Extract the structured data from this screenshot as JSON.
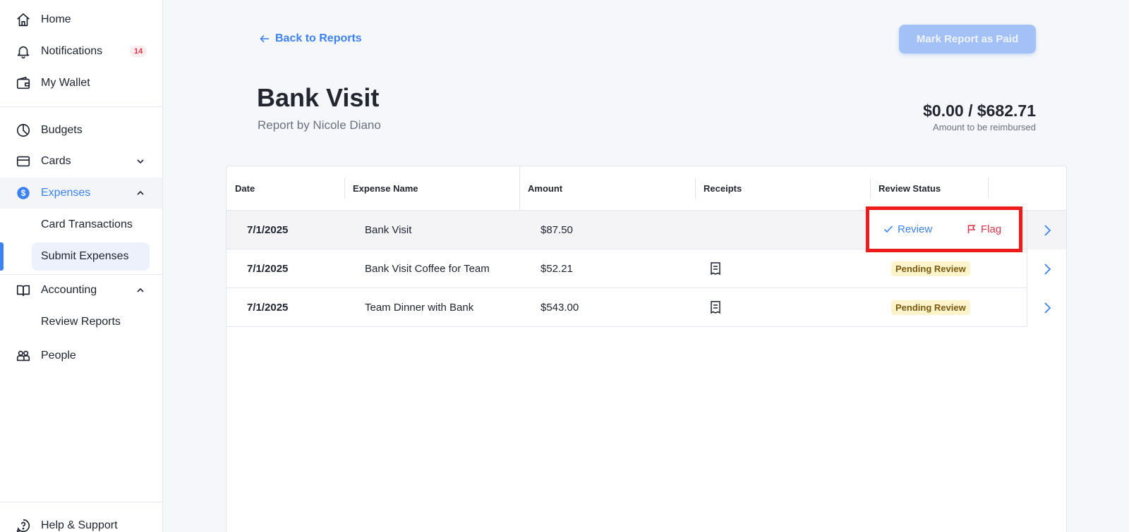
{
  "sidebar": {
    "nav": [
      {
        "label": "Home"
      },
      {
        "label": "Notifications",
        "badge": "14"
      },
      {
        "label": "My Wallet"
      },
      {
        "label": "Budgets"
      },
      {
        "label": "Cards"
      },
      {
        "label": "Expenses"
      },
      {
        "label": "Accounting"
      },
      {
        "label": "People"
      }
    ],
    "expenses_sub": [
      {
        "label": "Card Transactions"
      },
      {
        "label": "Submit Expenses"
      }
    ],
    "accounting_sub": [
      {
        "label": "Review Reports"
      }
    ],
    "help": "Help & Support"
  },
  "header": {
    "back_label": "Back to Reports",
    "mark_paid_label": "Mark Report as Paid"
  },
  "report": {
    "title": "Bank Visit",
    "subtitle": "Report by Nicole Diano",
    "total": "$0.00 / $682.71",
    "total_label": "Amount to be reimbursed"
  },
  "table": {
    "columns": [
      "Date",
      "Expense Name",
      "Amount",
      "Receipts",
      "Review Status"
    ],
    "rows": [
      {
        "date": "7/1/2025",
        "name": "Bank Visit",
        "amount": "$87.50",
        "receipt": false,
        "status": ""
      },
      {
        "date": "7/1/2025",
        "name": "Bank Visit Coffee for Team",
        "amount": "$52.21",
        "receipt": true,
        "status": "Pending Review"
      },
      {
        "date": "7/1/2025",
        "name": "Team Dinner with Bank",
        "amount": "$543.00",
        "receipt": true,
        "status": "Pending Review"
      }
    ],
    "actions": {
      "review": "Review",
      "flag": "Flag"
    }
  },
  "colors": {
    "accent": "#3b82f6",
    "danger": "#e0334a",
    "highlight": "#ee1b1b",
    "pending_bg": "#fdf4cc"
  }
}
